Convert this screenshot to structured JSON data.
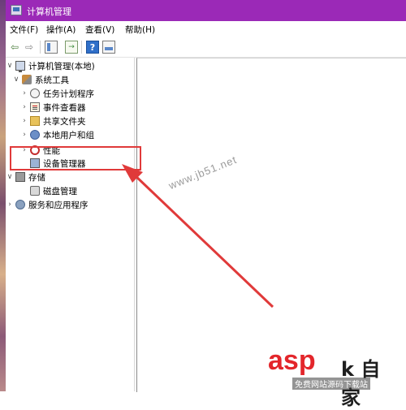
{
  "window": {
    "title": "计算机管理"
  },
  "menu": [
    {
      "label": "文件(F)"
    },
    {
      "label": "操作(A)"
    },
    {
      "label": "查看(V)"
    },
    {
      "label": "帮助(H)"
    }
  ],
  "toolbar": {
    "buttons": [
      "back-arrow-icon",
      "forward-arrow-icon",
      "show-hide-tree-icon",
      "export-list-icon",
      "help-icon",
      "show-hide-action-pane-icon"
    ]
  },
  "tree": [
    {
      "label": "计算机管理(本地)",
      "icon": "computer-icon",
      "expanded": true
    },
    {
      "label": "系统工具",
      "icon": "tools-icon",
      "expanded": true
    },
    {
      "label": "任务计划程序",
      "icon": "clock-icon",
      "expanded": false
    },
    {
      "label": "事件查看器",
      "icon": "event-log-icon",
      "expanded": false
    },
    {
      "label": "共享文件夹",
      "icon": "shared-folder-icon",
      "expanded": false
    },
    {
      "label": "本地用户和组",
      "icon": "users-icon",
      "expanded": false
    },
    {
      "label": "性能",
      "icon": "performance-icon",
      "expanded": false
    },
    {
      "label": "设备管理器",
      "icon": "device-manager-icon",
      "selected_highlight": true
    },
    {
      "label": "存储",
      "icon": "storage-icon",
      "expanded": true
    },
    {
      "label": "磁盘管理",
      "icon": "disk-icon"
    },
    {
      "label": "服务和应用程序",
      "icon": "services-icon",
      "expanded": false
    }
  ],
  "annotation": {
    "color": "#e03a3a"
  },
  "watermark": {
    "text": "www.jb51.net"
  },
  "brand": {
    "asp": "asp",
    "cn": "k 自 家",
    "sub": "免费网站源码下载站"
  },
  "colors": {
    "titlebar": "#9b29b7"
  }
}
